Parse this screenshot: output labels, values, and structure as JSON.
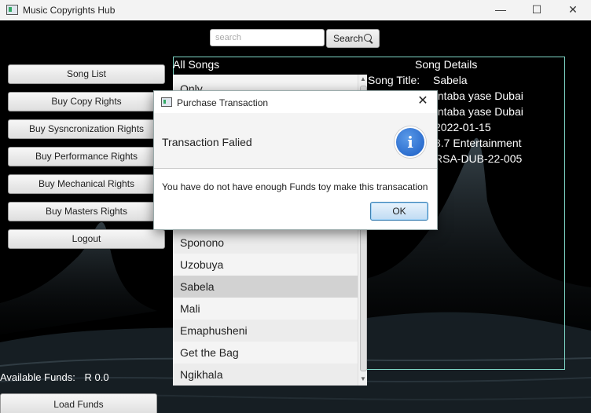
{
  "window": {
    "title": "Music Copyrights Hub",
    "minimize": "—",
    "maximize": "☐",
    "close": "✕"
  },
  "search": {
    "placeholder": "search",
    "button_label": "Search"
  },
  "nav": {
    "song_list": "Song List",
    "buy_copy_rights": "Buy Copy Rights",
    "buy_sync_rights": "Buy Sysncronization Rights",
    "buy_performance_rights": "Buy Performance Rights",
    "buy_mechanical_rights": "Buy Mechanical Rights",
    "buy_masters_rights": "Buy Masters Rights",
    "logout": "Logout"
  },
  "songs": {
    "header": "All Songs",
    "items": [
      "Only",
      "Sponono",
      "Uzobuya",
      "Sabela",
      "Mali",
      "Emaphusheni",
      "Get the Bag",
      "Ngikhala"
    ],
    "selected": "Sabela"
  },
  "details": {
    "header": "Song Details",
    "title_label": "Song Title:",
    "title_value": "Sabela",
    "line2": "Intaba yase Dubai",
    "line3": "Intaba yase Dubai",
    "line4": "2022-01-15",
    "line5": "3.7 Entertainment",
    "line6": "RSA-DUB-22-005"
  },
  "funds": {
    "label": "Available Funds:",
    "value": "R 0.0",
    "load_button": "Load Funds"
  },
  "dialog": {
    "title": "Purchase Transaction",
    "header": "Transaction Falied",
    "message": "You have do not have enough Funds toy make this transacation",
    "ok_label": "OK",
    "close": "✕",
    "icon": "info-icon"
  }
}
